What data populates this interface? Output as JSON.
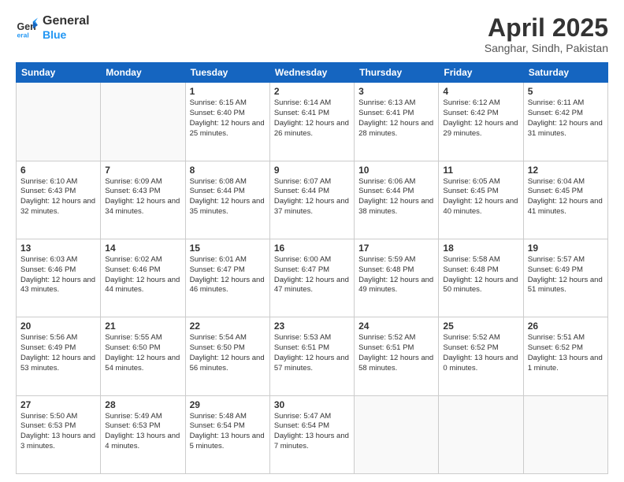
{
  "header": {
    "logo_line1": "General",
    "logo_line2": "Blue",
    "title": "April 2025",
    "subtitle": "Sanghar, Sindh, Pakistan"
  },
  "weekdays": [
    "Sunday",
    "Monday",
    "Tuesday",
    "Wednesday",
    "Thursday",
    "Friday",
    "Saturday"
  ],
  "weeks": [
    [
      {
        "day": "",
        "info": ""
      },
      {
        "day": "",
        "info": ""
      },
      {
        "day": "1",
        "info": "Sunrise: 6:15 AM\nSunset: 6:40 PM\nDaylight: 12 hours and 25 minutes."
      },
      {
        "day": "2",
        "info": "Sunrise: 6:14 AM\nSunset: 6:41 PM\nDaylight: 12 hours and 26 minutes."
      },
      {
        "day": "3",
        "info": "Sunrise: 6:13 AM\nSunset: 6:41 PM\nDaylight: 12 hours and 28 minutes."
      },
      {
        "day": "4",
        "info": "Sunrise: 6:12 AM\nSunset: 6:42 PM\nDaylight: 12 hours and 29 minutes."
      },
      {
        "day": "5",
        "info": "Sunrise: 6:11 AM\nSunset: 6:42 PM\nDaylight: 12 hours and 31 minutes."
      }
    ],
    [
      {
        "day": "6",
        "info": "Sunrise: 6:10 AM\nSunset: 6:43 PM\nDaylight: 12 hours and 32 minutes."
      },
      {
        "day": "7",
        "info": "Sunrise: 6:09 AM\nSunset: 6:43 PM\nDaylight: 12 hours and 34 minutes."
      },
      {
        "day": "8",
        "info": "Sunrise: 6:08 AM\nSunset: 6:44 PM\nDaylight: 12 hours and 35 minutes."
      },
      {
        "day": "9",
        "info": "Sunrise: 6:07 AM\nSunset: 6:44 PM\nDaylight: 12 hours and 37 minutes."
      },
      {
        "day": "10",
        "info": "Sunrise: 6:06 AM\nSunset: 6:44 PM\nDaylight: 12 hours and 38 minutes."
      },
      {
        "day": "11",
        "info": "Sunrise: 6:05 AM\nSunset: 6:45 PM\nDaylight: 12 hours and 40 minutes."
      },
      {
        "day": "12",
        "info": "Sunrise: 6:04 AM\nSunset: 6:45 PM\nDaylight: 12 hours and 41 minutes."
      }
    ],
    [
      {
        "day": "13",
        "info": "Sunrise: 6:03 AM\nSunset: 6:46 PM\nDaylight: 12 hours and 43 minutes."
      },
      {
        "day": "14",
        "info": "Sunrise: 6:02 AM\nSunset: 6:46 PM\nDaylight: 12 hours and 44 minutes."
      },
      {
        "day": "15",
        "info": "Sunrise: 6:01 AM\nSunset: 6:47 PM\nDaylight: 12 hours and 46 minutes."
      },
      {
        "day": "16",
        "info": "Sunrise: 6:00 AM\nSunset: 6:47 PM\nDaylight: 12 hours and 47 minutes."
      },
      {
        "day": "17",
        "info": "Sunrise: 5:59 AM\nSunset: 6:48 PM\nDaylight: 12 hours and 49 minutes."
      },
      {
        "day": "18",
        "info": "Sunrise: 5:58 AM\nSunset: 6:48 PM\nDaylight: 12 hours and 50 minutes."
      },
      {
        "day": "19",
        "info": "Sunrise: 5:57 AM\nSunset: 6:49 PM\nDaylight: 12 hours and 51 minutes."
      }
    ],
    [
      {
        "day": "20",
        "info": "Sunrise: 5:56 AM\nSunset: 6:49 PM\nDaylight: 12 hours and 53 minutes."
      },
      {
        "day": "21",
        "info": "Sunrise: 5:55 AM\nSunset: 6:50 PM\nDaylight: 12 hours and 54 minutes."
      },
      {
        "day": "22",
        "info": "Sunrise: 5:54 AM\nSunset: 6:50 PM\nDaylight: 12 hours and 56 minutes."
      },
      {
        "day": "23",
        "info": "Sunrise: 5:53 AM\nSunset: 6:51 PM\nDaylight: 12 hours and 57 minutes."
      },
      {
        "day": "24",
        "info": "Sunrise: 5:52 AM\nSunset: 6:51 PM\nDaylight: 12 hours and 58 minutes."
      },
      {
        "day": "25",
        "info": "Sunrise: 5:52 AM\nSunset: 6:52 PM\nDaylight: 13 hours and 0 minutes."
      },
      {
        "day": "26",
        "info": "Sunrise: 5:51 AM\nSunset: 6:52 PM\nDaylight: 13 hours and 1 minute."
      }
    ],
    [
      {
        "day": "27",
        "info": "Sunrise: 5:50 AM\nSunset: 6:53 PM\nDaylight: 13 hours and 3 minutes."
      },
      {
        "day": "28",
        "info": "Sunrise: 5:49 AM\nSunset: 6:53 PM\nDaylight: 13 hours and 4 minutes."
      },
      {
        "day": "29",
        "info": "Sunrise: 5:48 AM\nSunset: 6:54 PM\nDaylight: 13 hours and 5 minutes."
      },
      {
        "day": "30",
        "info": "Sunrise: 5:47 AM\nSunset: 6:54 PM\nDaylight: 13 hours and 7 minutes."
      },
      {
        "day": "",
        "info": ""
      },
      {
        "day": "",
        "info": ""
      },
      {
        "day": "",
        "info": ""
      }
    ]
  ]
}
